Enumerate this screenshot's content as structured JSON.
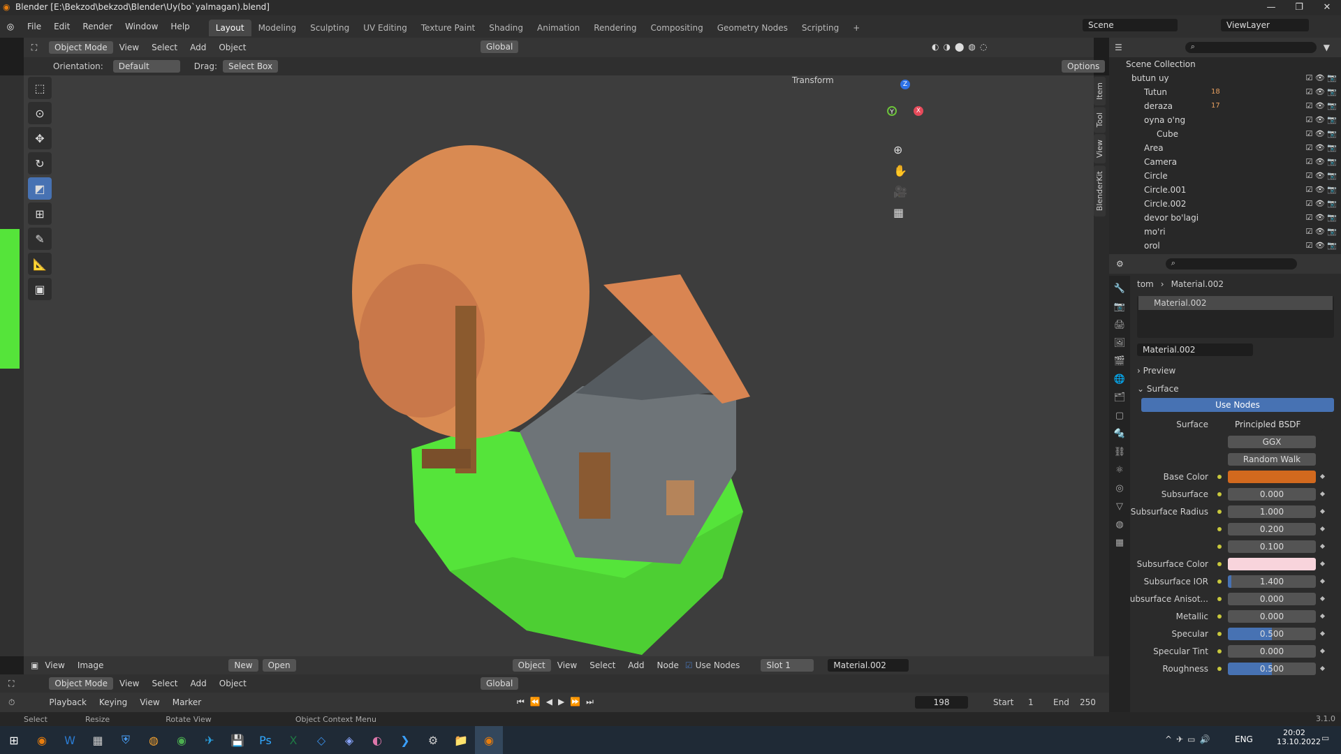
{
  "window": {
    "title": "Blender [E:\\Bekzod\\bekzod\\Blender\\Uy(bo`yalmagan).blend]",
    "min": "—",
    "max": "❐",
    "close": "✕"
  },
  "menu": [
    "File",
    "Edit",
    "Render",
    "Window",
    "Help"
  ],
  "workspaces": [
    "Layout",
    "Modeling",
    "Sculpting",
    "UV Editing",
    "Texture Paint",
    "Shading",
    "Animation",
    "Rendering",
    "Compositing",
    "Geometry Nodes",
    "Scripting"
  ],
  "scene": {
    "scene_label": "Scene",
    "view_layer": "ViewLayer"
  },
  "viewport": {
    "mode": "Object Mode",
    "menus": [
      "View",
      "Select",
      "Add",
      "Object"
    ],
    "transform": "Global",
    "orientation_label": "Orientation:",
    "orientation_value": "Default",
    "drag_label": "Drag:",
    "drag_value": "Select Box",
    "options": "Options",
    "transform_panel": "Transform",
    "side_tabs": [
      "Item",
      "Tool",
      "View",
      "BlenderKit"
    ],
    "gizmo": {
      "x": "X",
      "y": "Y",
      "z": "Z"
    }
  },
  "outliner": {
    "root": "Scene Collection",
    "rows": [
      {
        "name": "butun uy",
        "indent": 1
      },
      {
        "name": "Tutun",
        "indent": 2,
        "badge": "18"
      },
      {
        "name": "deraza",
        "indent": 2,
        "badge": "17"
      },
      {
        "name": "oyna o'ng",
        "indent": 2
      },
      {
        "name": "Cube",
        "indent": 3
      },
      {
        "name": "Area",
        "indent": 2
      },
      {
        "name": "Camera",
        "indent": 2
      },
      {
        "name": "Circle",
        "indent": 2
      },
      {
        "name": "Circle.001",
        "indent": 2
      },
      {
        "name": "Circle.002",
        "indent": 2
      },
      {
        "name": "devor bo'lagi",
        "indent": 2
      },
      {
        "name": "mo'ri",
        "indent": 2
      },
      {
        "name": "orol",
        "indent": 2
      }
    ]
  },
  "properties": {
    "breadcrumb_obj": "tom",
    "breadcrumb_mat": "Material.002",
    "slot": "Material.002",
    "material": "Material.002",
    "preview": "Preview",
    "surface_section": "Surface",
    "use_nodes": "Use Nodes",
    "surface_label": "Surface",
    "surface_value": "Principled BSDF",
    "distribution": "GGX",
    "subsurface_method": "Random Walk",
    "rows": [
      {
        "label": "Base Color",
        "value": "",
        "color": "#d2691e"
      },
      {
        "label": "Subsurface",
        "value": "0.000"
      },
      {
        "label": "Subsurface Radius",
        "value": "1.000"
      },
      {
        "label": "",
        "value": "0.200"
      },
      {
        "label": "",
        "value": "0.100"
      },
      {
        "label": "Subsurface Color",
        "value": "",
        "color": "#f8d4dc"
      },
      {
        "label": "Subsurface IOR",
        "value": "1.400",
        "fill": 0.04
      },
      {
        "label": "Subsurface Anisot...",
        "value": "0.000"
      },
      {
        "label": "Metallic",
        "value": "0.000"
      },
      {
        "label": "Specular",
        "value": "0.500",
        "fill": 0.5
      },
      {
        "label": "Specular Tint",
        "value": "0.000"
      },
      {
        "label": "Roughness",
        "value": "0.500",
        "fill": 0.5
      }
    ]
  },
  "image_editor": {
    "menus": [
      "View",
      "Image"
    ],
    "new": "New",
    "open": "Open",
    "object": "Object",
    "node_menus": [
      "View",
      "Select",
      "Add",
      "Node"
    ],
    "use_nodes": "Use Nodes",
    "slot": "Slot 1",
    "material": "Material.002"
  },
  "bottom_viewport": {
    "mode": "Object Mode",
    "menus": [
      "View",
      "Select",
      "Add",
      "Object"
    ],
    "transform": "Global"
  },
  "timeline": {
    "menus": [
      "Playback",
      "Keying",
      "View",
      "Marker"
    ],
    "frame": "198",
    "start_label": "Start",
    "start": "1",
    "end_label": "End",
    "end": "250"
  },
  "status": {
    "select": "Select",
    "resize": "Resize",
    "rotate": "Rotate View",
    "context": "Object Context Menu",
    "version": "3.1.0"
  },
  "taskbar": {
    "lang": "ENG",
    "time": "20:02",
    "date": "13.10.2022"
  }
}
